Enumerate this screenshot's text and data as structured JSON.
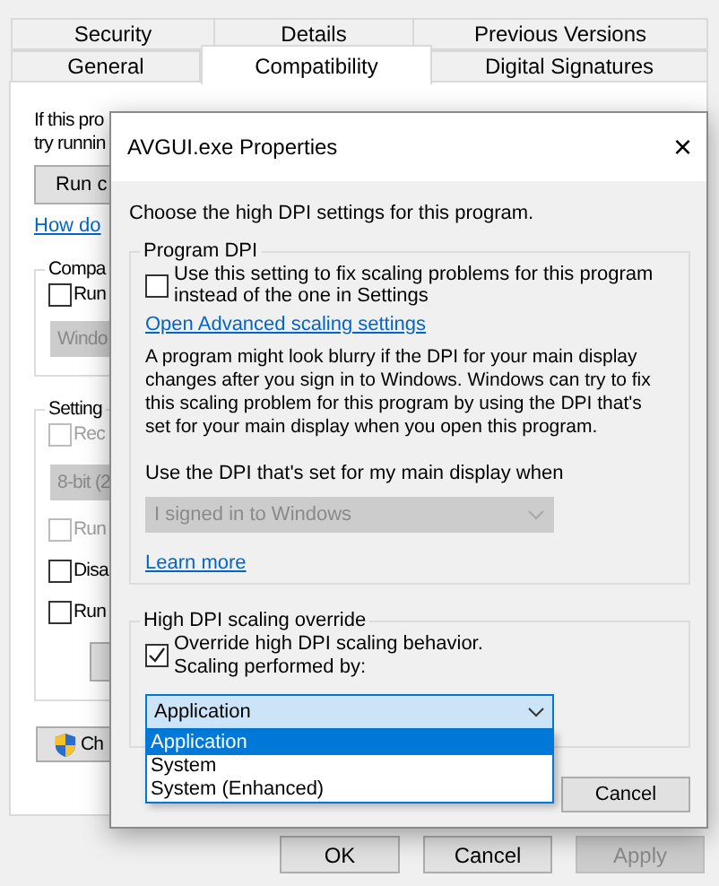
{
  "properties_window": {
    "tabs_row_1": [
      {
        "label": "Security",
        "selected": false
      },
      {
        "label": "Details",
        "selected": false
      },
      {
        "label": "Previous Versions",
        "selected": false
      }
    ],
    "tabs_row_2": [
      {
        "label": "General",
        "selected": false
      },
      {
        "label": "Compatibility",
        "selected": true
      },
      {
        "label": "Digital Signatures",
        "selected": false
      }
    ],
    "description_lines": [
      "If this pro",
      "try runnin"
    ],
    "run_button": "Run c",
    "help_link": "How do",
    "compatibility_group": {
      "title": "Compa",
      "checkbox": {
        "label": "Run",
        "checked": false
      },
      "dropdown": {
        "value": "Windo",
        "disabled": true
      }
    },
    "settings_group": {
      "title": "Setting",
      "items": [
        {
          "kind": "checkbox",
          "label": "Rec",
          "checked": false,
          "disabled": true
        },
        {
          "kind": "dropdown",
          "value": "8-bit (2",
          "disabled": true
        },
        {
          "kind": "checkbox",
          "label": "Run",
          "checked": false,
          "disabled": true
        },
        {
          "kind": "checkbox",
          "label": "Disa",
          "checked": false,
          "disabled": false
        },
        {
          "kind": "checkbox",
          "label": "Run",
          "checked": false,
          "disabled": false
        },
        {
          "kind": "button"
        }
      ]
    },
    "change_settings_button": "Ch",
    "buttons": [
      {
        "label": "OK",
        "disabled": false
      },
      {
        "label": "Cancel",
        "disabled": false
      },
      {
        "label": "Apply",
        "disabled": true
      }
    ]
  },
  "dialog": {
    "title": "AVGUI.exe Properties",
    "close": "×",
    "instruction": "Choose the high DPI settings for this program.",
    "program_dpi": {
      "title": "Program DPI",
      "checkbox": {
        "label_lines": [
          "Use this setting to fix scaling problems for this program",
          "instead of the one in Settings"
        ],
        "checked": false
      },
      "advanced_link": "Open Advanced scaling settings",
      "paragraph_lines": [
        "A program might look blurry if the DPI for your main display",
        "changes after you sign in to Windows. Windows can try to fix",
        "this scaling problem for this program by using the DPI that's",
        "set for your main display when you open this program."
      ],
      "dropdown_label": "Use the DPI that's set for my main display when",
      "dropdown": {
        "value": "I signed in to Windows",
        "disabled": true
      },
      "learn_more_link": "Learn more"
    },
    "override": {
      "title": "High DPI scaling override",
      "checkbox": {
        "label_lines": [
          "Override high DPI scaling behavior.",
          "Scaling performed by:"
        ],
        "checked": true
      },
      "dropdown": {
        "value": "Application",
        "expanded": true,
        "options": [
          {
            "label": "Application",
            "selected": true
          },
          {
            "label": "System",
            "selected": false
          },
          {
            "label": "System (Enhanced)",
            "selected": false
          }
        ]
      }
    },
    "buttons": [
      {
        "label": "Cancel"
      }
    ]
  }
}
